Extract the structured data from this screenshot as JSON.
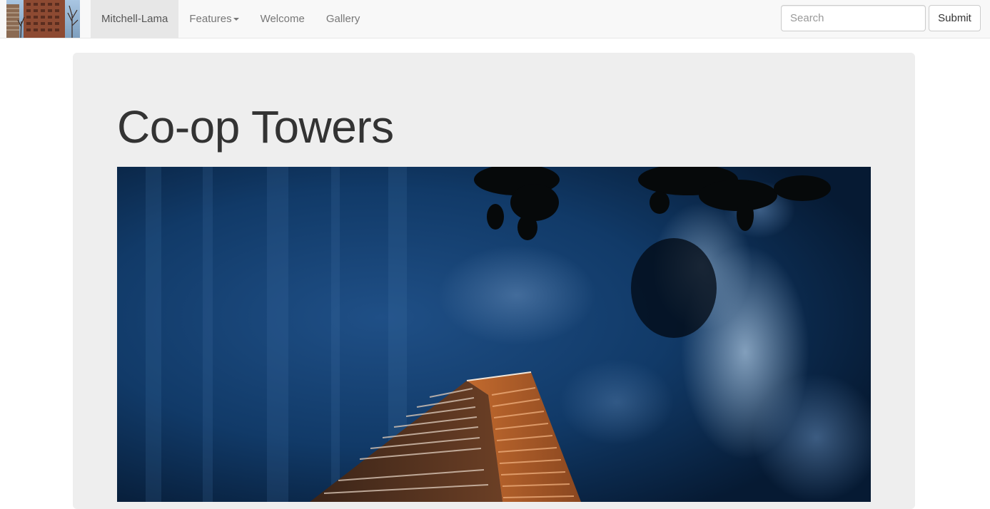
{
  "navbar": {
    "brand_logo_alt": "Co-op Towers building thumbnail",
    "items": [
      {
        "label": "Mitchell-Lama",
        "active": true
      },
      {
        "label": "Features",
        "has_dropdown": true
      },
      {
        "label": "Welcome"
      },
      {
        "label": "Gallery"
      }
    ],
    "search": {
      "placeholder": "Search",
      "value": ""
    },
    "submit_label": "Submit"
  },
  "jumbotron": {
    "title": "Co-op Towers",
    "image_alt": "Co-op Towers residential tower against a dark blue sky"
  },
  "colors": {
    "navbar_bg": "#f8f8f8",
    "jumbotron_bg": "#eeeeee",
    "sky_dark": "#0a1f3a",
    "tower_copper": "#b8622a"
  }
}
